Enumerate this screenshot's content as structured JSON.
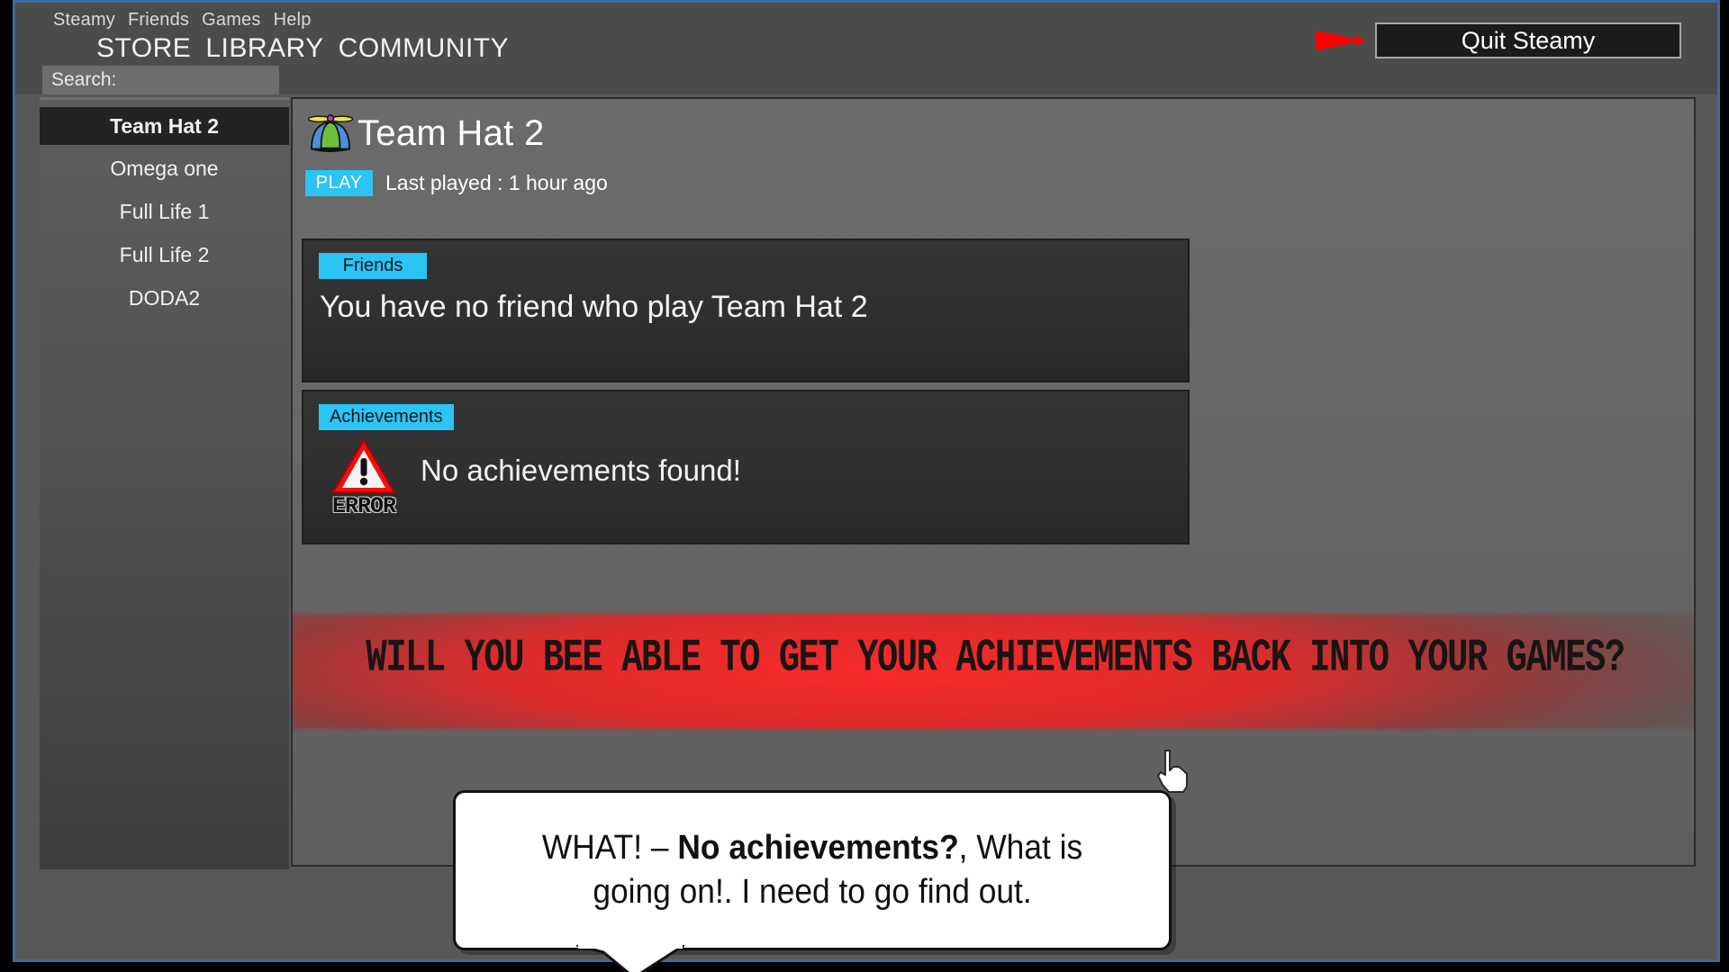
{
  "app": {
    "menu_items": [
      "Steamy",
      "Friends",
      "Games",
      "Help"
    ],
    "nav_items": [
      "STORE",
      "LIBRARY",
      "COMMUNITY"
    ],
    "search_label": "Search:",
    "search_value": "",
    "search_placeholder": "",
    "quit_button_label": "Quit Steamy",
    "accent_color": "#2cc3f5",
    "arrow_color": "#ff0000"
  },
  "sidebar": {
    "games": [
      {
        "label": "Team Hat 2",
        "selected": true
      },
      {
        "label": "Omega one",
        "selected": false
      },
      {
        "label": "Full Life 1",
        "selected": false
      },
      {
        "label": "Full Life 2",
        "selected": false
      },
      {
        "label": "DODA2",
        "selected": false
      }
    ]
  },
  "main": {
    "game_title": "Team Hat 2",
    "game_icon": "propeller-hat-icon",
    "play_label": "PLAY",
    "last_played": "Last played : 1 hour ago",
    "friends_card": {
      "tab_label": "Friends",
      "body": "You have no friend who play Team Hat 2"
    },
    "achievements_card": {
      "tab_label": "Achievements",
      "icon": "error-warning-triangle-icon",
      "error_word": "ERROR",
      "body": "No achievements found!"
    }
  },
  "overlay": {
    "banner_text": "WILL YOU BEE ABLE TO GET YOUR ACHIEVEMENTS BACK INTO YOUR GAMES?",
    "banner_color": "#ee2424",
    "cursor": "pointing-hand-cursor",
    "speech_bubble": {
      "prefix": "WHAT! – ",
      "bold": "No achievements?",
      "suffix": ", What is going on!. I need to go find out."
    }
  }
}
